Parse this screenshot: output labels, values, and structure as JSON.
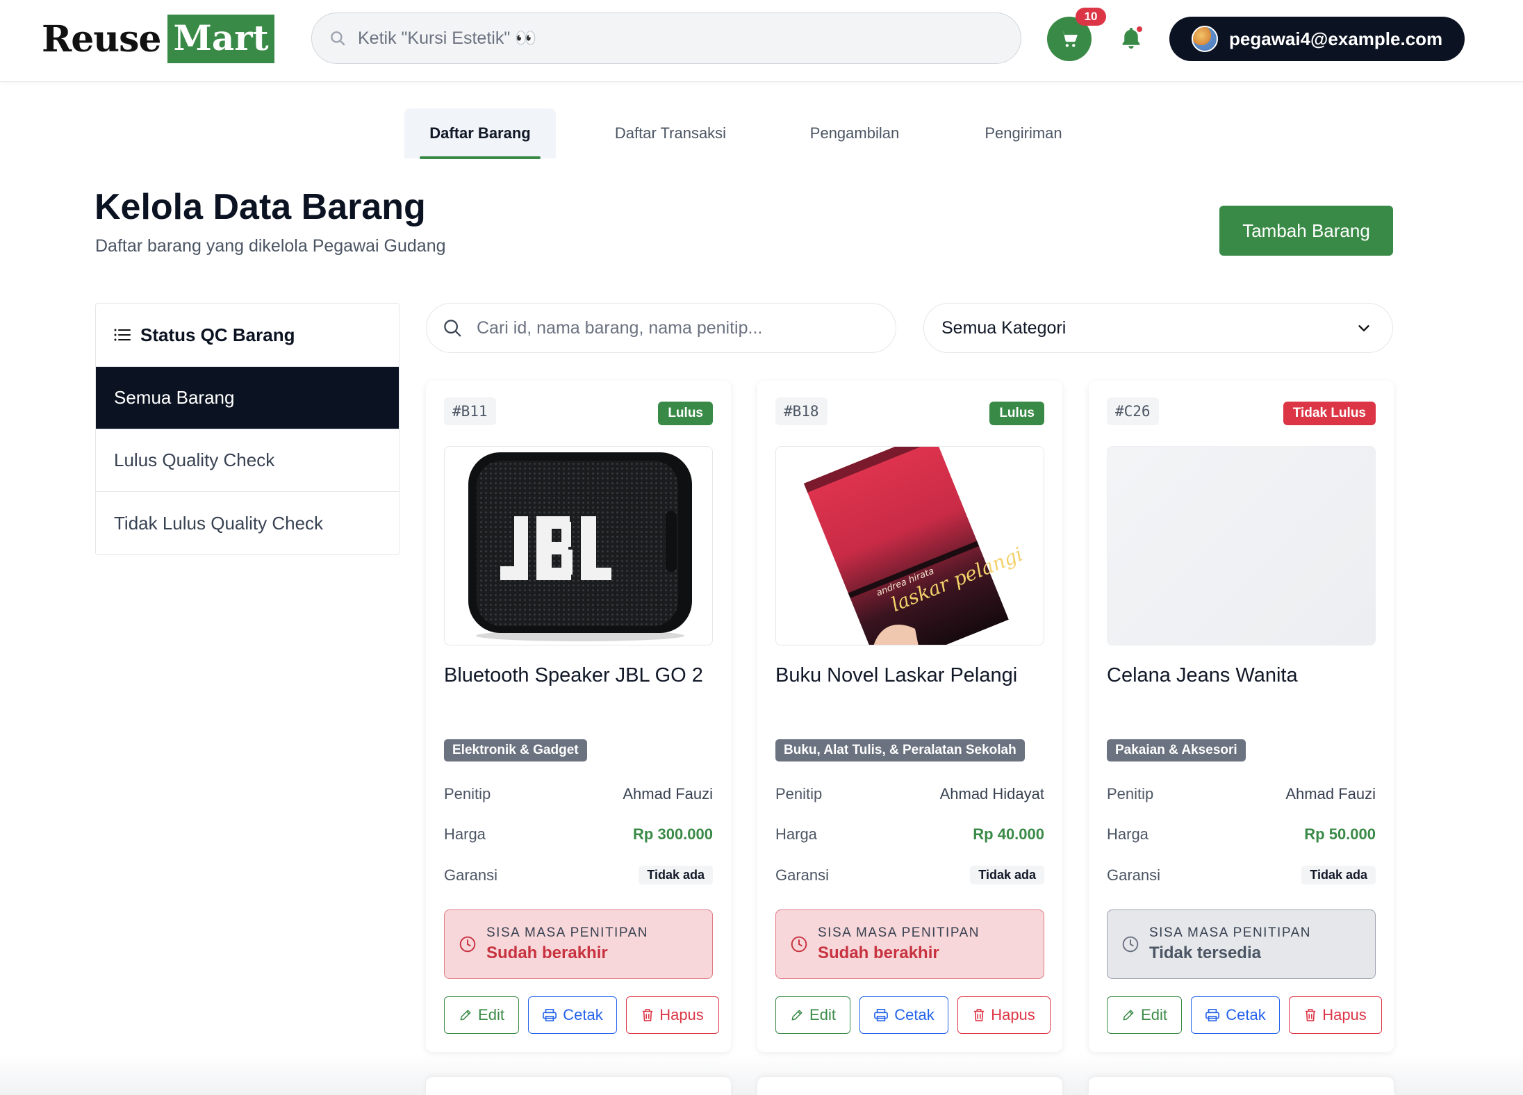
{
  "header": {
    "logo_left": "Reuse",
    "logo_right": "Mart",
    "search_placeholder": "Ketik \"Kursi Estetik\" 👀",
    "cart_count": "10",
    "user_email": "pegawai4@example.com"
  },
  "tabs": [
    {
      "label": "Daftar Barang",
      "active": true
    },
    {
      "label": "Daftar Transaksi",
      "active": false
    },
    {
      "label": "Pengambilan",
      "active": false
    },
    {
      "label": "Pengiriman",
      "active": false
    }
  ],
  "page": {
    "title": "Kelola Data Barang",
    "subtitle": "Daftar barang yang dikelola Pegawai Gudang",
    "add_button": "Tambah Barang"
  },
  "sidebar": {
    "heading": "Status QC Barang",
    "items": [
      {
        "label": "Semua Barang",
        "active": true
      },
      {
        "label": "Lulus Quality Check",
        "active": false
      },
      {
        "label": "Tidak Lulus Quality Check",
        "active": false
      }
    ]
  },
  "filters": {
    "search_placeholder": "Cari id, nama barang, nama penitip...",
    "category_selected": "Semua Kategori"
  },
  "labels": {
    "penitip": "Penitip",
    "harga": "Harga",
    "garansi": "Garansi",
    "masa": "SISA MASA PENITIPAN",
    "edit": "Edit",
    "cetak": "Cetak",
    "hapus": "Hapus"
  },
  "items": [
    {
      "code": "#B11",
      "qc": "Lulus",
      "name": "Bluetooth Speaker JBL GO 2",
      "category": "Elektronik & Gadget",
      "penitip": "Ahmad Fauzi",
      "harga": "Rp 300.000",
      "garansi": "Tidak ada",
      "masa_status": "Sudah berakhir",
      "image_icon": "speaker-image"
    },
    {
      "code": "#B18",
      "qc": "Lulus",
      "name": "Buku Novel Laskar Pelangi",
      "category": "Buku, Alat Tulis, & Peralatan Sekolah",
      "penitip": "Ahmad Hidayat",
      "harga": "Rp 40.000",
      "garansi": "Tidak ada",
      "masa_status": "Sudah berakhir",
      "image_icon": "book-image",
      "book_cover_text": "laskar pelangi",
      "book_author_text": "andrea hirata"
    },
    {
      "code": "#C26",
      "qc": "Tidak Lulus",
      "name": "Celana Jeans Wanita",
      "category": "Pakaian & Aksesori",
      "penitip": "Ahmad Fauzi",
      "harga": "Rp 50.000",
      "garansi": "Tidak ada",
      "masa_status": "Tidak tersedia",
      "image_icon": "image-placeholder"
    }
  ],
  "colors": {
    "brand_green": "#3a8a47",
    "navy": "#0b1221",
    "danger": "#dc3545",
    "info": "#2563eb"
  }
}
